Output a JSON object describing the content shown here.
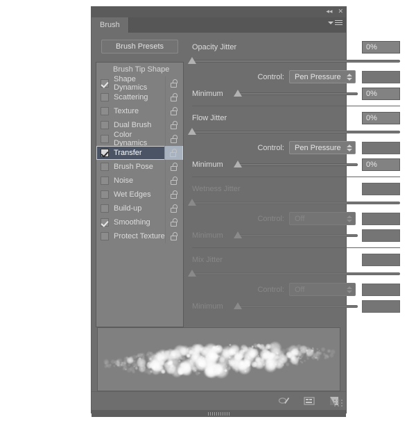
{
  "window": {
    "tab_label": "Brush",
    "collapse_icon": "collapse-arrows-icon",
    "close_icon": "close-icon",
    "menu_icon": "panel-menu-icon"
  },
  "left": {
    "presets_button": "Brush Presets",
    "list_header": "Brush Tip Shape",
    "items": [
      {
        "label": "Shape Dynamics",
        "checked": true,
        "selected": false
      },
      {
        "label": "Scattering",
        "checked": false,
        "selected": false
      },
      {
        "label": "Texture",
        "checked": false,
        "selected": false
      },
      {
        "label": "Dual Brush",
        "checked": false,
        "selected": false
      },
      {
        "label": "Color Dynamics",
        "checked": false,
        "selected": false
      },
      {
        "label": "Transfer",
        "checked": true,
        "selected": true
      },
      {
        "label": "Brush Pose",
        "checked": false,
        "selected": false
      },
      {
        "label": "Noise",
        "checked": false,
        "selected": false
      },
      {
        "label": "Wet Edges",
        "checked": false,
        "selected": false
      },
      {
        "label": "Build-up",
        "checked": false,
        "selected": false
      },
      {
        "label": "Smoothing",
        "checked": true,
        "selected": false
      },
      {
        "label": "Protect Texture",
        "checked": false,
        "selected": false
      }
    ],
    "lock_icon": "lock-open-icon"
  },
  "right": {
    "control_label": "Control:",
    "minimum_label": "Minimum",
    "sections": [
      {
        "title": "Opacity Jitter",
        "value": "0%",
        "slider_pct": 0,
        "control": "Pen Pressure",
        "minimum_value": "0%",
        "minimum_pct": 0,
        "enabled": true
      },
      {
        "title": "Flow Jitter",
        "value": "0%",
        "slider_pct": 0,
        "control": "Pen Pressure",
        "minimum_value": "0%",
        "minimum_pct": 0,
        "enabled": true
      },
      {
        "title": "Wetness Jitter",
        "value": "",
        "slider_pct": 0,
        "control": "Off",
        "minimum_value": "",
        "minimum_pct": 0,
        "enabled": false
      },
      {
        "title": "Mix Jitter",
        "value": "",
        "slider_pct": 0,
        "control": "Off",
        "minimum_value": "",
        "minimum_pct": 0,
        "enabled": false
      }
    ]
  },
  "footer": {
    "icons": [
      "toggle-brush-pressure-icon",
      "brush-preview-icon",
      "new-brush-icon"
    ],
    "resize_grip": "resize-grip-icon"
  }
}
